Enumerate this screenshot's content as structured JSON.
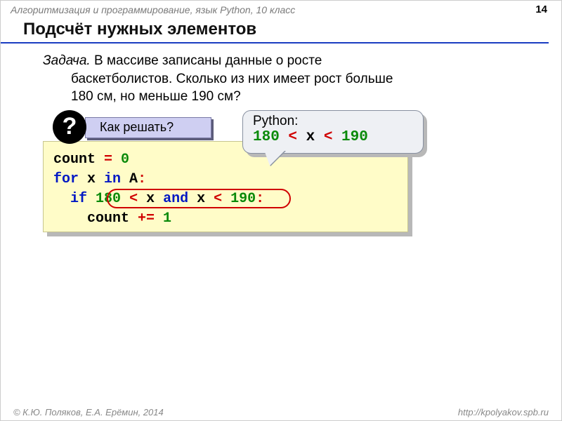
{
  "header": {
    "subject": "Алгоритмизация и программирование, язык Python, 10 класс",
    "page": "14"
  },
  "title": "Подсчёт нужных элементов",
  "problem": {
    "label": "Задача.",
    "line1": " В массиве записаны данные о росте",
    "line2": "баскетболистов. Сколько из них имеет рост больше",
    "line3": "180 см, но меньше 190 см?"
  },
  "question": {
    "mark": "?",
    "text": "Как решать?"
  },
  "code": {
    "l1a": "count ",
    "l1op": "= ",
    "l1n": "0",
    "l2a": "for",
    "l2b": " x ",
    "l2c": "in",
    "l2d": " A",
    "l3a": "if",
    "l3n1": "180",
    "l3op1": " < ",
    "l3x": "x ",
    "l3and": "and",
    "l3x2": " x ",
    "l3op2": "< ",
    "l3n2": "190",
    "l4a": "count ",
    "l4op": "+= ",
    "l4n": "1"
  },
  "bubble": {
    "title": "Python:",
    "n1": "180",
    "op": " < ",
    "x": "x",
    "n2": "190"
  },
  "footer": {
    "left": "© К.Ю. Поляков, Е.А. Ерёмин, 2014",
    "right": "http://kpolyakov.spb.ru"
  }
}
